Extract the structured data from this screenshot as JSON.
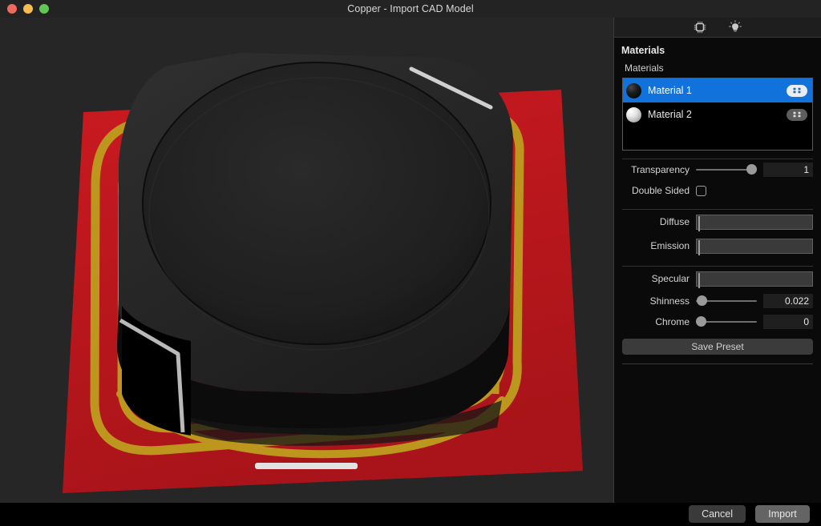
{
  "window": {
    "title": "Copper - Import CAD Model",
    "traffic_lights": [
      {
        "name": "close",
        "color": "#ED6A5F"
      },
      {
        "name": "minimize",
        "color": "#F5BD4F"
      },
      {
        "name": "zoom",
        "color": "#61C554"
      }
    ]
  },
  "viewport": {
    "name": "3d-model-viewport",
    "background": "#262626",
    "model_description": "Shielded power inductor on red PCB with gold copper traces",
    "colors": {
      "pcb_red": "#C0181E",
      "copper_gold": "#BD961E",
      "body_dark": "#262626",
      "body_black": "#0d0d0d",
      "pad_silver": "#d8d8d8"
    }
  },
  "panel": {
    "toolbar": {
      "icons": [
        {
          "name": "chip-icon",
          "label": "Materials"
        },
        {
          "name": "light-bulb-icon",
          "label": "Lighting"
        }
      ]
    },
    "header": "Materials",
    "materials_section_label": "Materials",
    "materials": [
      {
        "name": "Material 1",
        "swatch": "dark",
        "selected": true,
        "button_icon": "grid-icon"
      },
      {
        "name": "Material 2",
        "swatch": "light",
        "selected": false,
        "button_icon": "grid-icon"
      }
    ],
    "selection_color": "#1272DB",
    "controls": {
      "transparency": {
        "label": "Transparency",
        "value": "1",
        "percent": 100
      },
      "double_sided": {
        "label": "Double Sided",
        "checked": false
      },
      "diffuse": {
        "label": "Diffuse",
        "color": "#1e1e1e"
      },
      "emission": {
        "label": "Emission",
        "color": "#000000"
      },
      "specular": {
        "label": "Specular",
        "color": "#000000"
      },
      "shinness": {
        "label": "Shinness",
        "value": "0.022",
        "percent": 2
      },
      "chrome": {
        "label": "Chrome",
        "value": "0",
        "percent": 0
      }
    },
    "save_preset_label": "Save Preset"
  },
  "footer": {
    "cancel_label": "Cancel",
    "import_label": "Import"
  }
}
